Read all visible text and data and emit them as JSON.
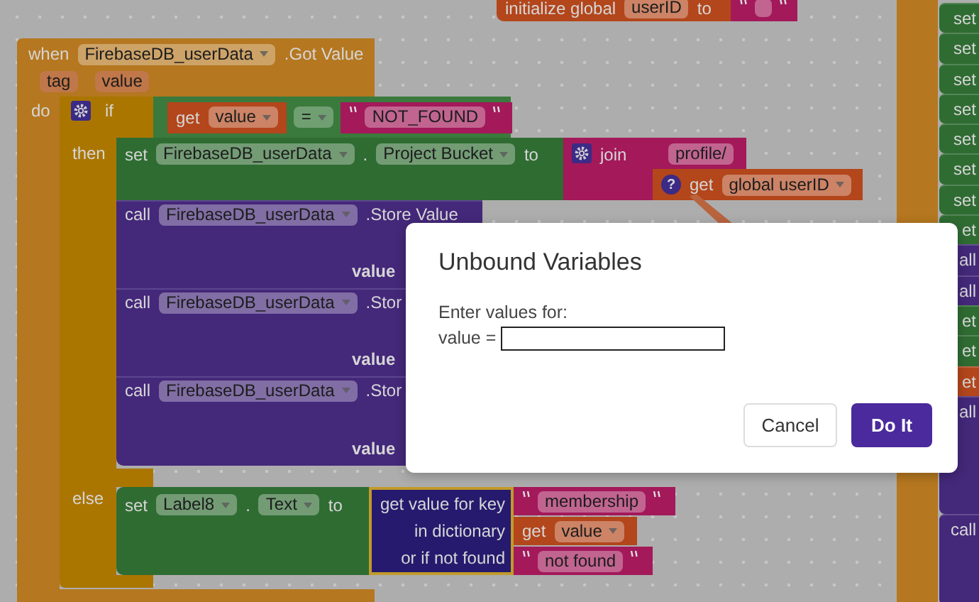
{
  "workspace": {
    "init_block": {
      "label": "initialize global",
      "name": "userID",
      "to": "to"
    },
    "event": {
      "keyword": "when",
      "component": "FirebaseDB_userData",
      "event": ".Got Value",
      "params": [
        "tag",
        "value"
      ],
      "do_label": "do"
    },
    "if_block": {
      "keyword": "if",
      "then_label": "then",
      "else_label": "else"
    },
    "condition": {
      "get": "get",
      "variable": "value",
      "operator": "=",
      "text": "NOT_FOUND"
    },
    "set_block": {
      "keyword": "set",
      "component": "FirebaseDB_userData",
      "dot": ".",
      "property": "Project Bucket",
      "to": "to"
    },
    "join_block": {
      "label": "join",
      "text": "profile/",
      "get": "get",
      "variable": "global userID",
      "warning": "?"
    },
    "calls": [
      {
        "keyword": "call",
        "component": "FirebaseDB_userData",
        "method": ".Store Value",
        "param": "value"
      },
      {
        "keyword": "call",
        "component": "FirebaseDB_userData",
        "method": ".Stor",
        "param": "value"
      },
      {
        "keyword": "call",
        "component": "FirebaseDB_userData",
        "method": ".Stor",
        "param": "value"
      }
    ],
    "else_set": {
      "keyword": "set",
      "component": "Label8",
      "dot": ".",
      "property": "Text",
      "to": "to"
    },
    "dictionary": {
      "lines": [
        "get value for key",
        "in dictionary",
        "or if not found"
      ],
      "key": "membership",
      "get": "get",
      "variable": "value",
      "default": "not found"
    },
    "side_stack": [
      {
        "kind": "set",
        "label": "set",
        "tall": false
      },
      {
        "kind": "set",
        "label": "set",
        "tall": false
      },
      {
        "kind": "set",
        "label": "set",
        "tall": false
      },
      {
        "kind": "set",
        "label": "set",
        "tall": false
      },
      {
        "kind": "set",
        "label": "set",
        "tall": false
      },
      {
        "kind": "set",
        "label": "set",
        "tall": false
      },
      {
        "kind": "set",
        "label": "set",
        "tall": false
      },
      {
        "kind": "set",
        "label": "et",
        "tall": false
      },
      {
        "kind": "call",
        "label": "all",
        "tall": false
      },
      {
        "kind": "call",
        "label": "all",
        "tall": false
      },
      {
        "kind": "set",
        "label": "et",
        "tall": false
      },
      {
        "kind": "set",
        "label": "et",
        "tall": false
      },
      {
        "kind": "variable",
        "label": "et",
        "tall": false
      },
      {
        "kind": "call",
        "label": "all",
        "tall": true
      },
      {
        "kind": "call",
        "label": "call",
        "tall": false
      }
    ]
  },
  "dialog": {
    "title": "Unbound Variables",
    "prompt": "Enter values for:",
    "field_label": "value =",
    "buttons": [
      {
        "label": "Cancel",
        "kind": "secondary"
      },
      {
        "label": "Do It",
        "kind": "primary"
      }
    ]
  }
}
